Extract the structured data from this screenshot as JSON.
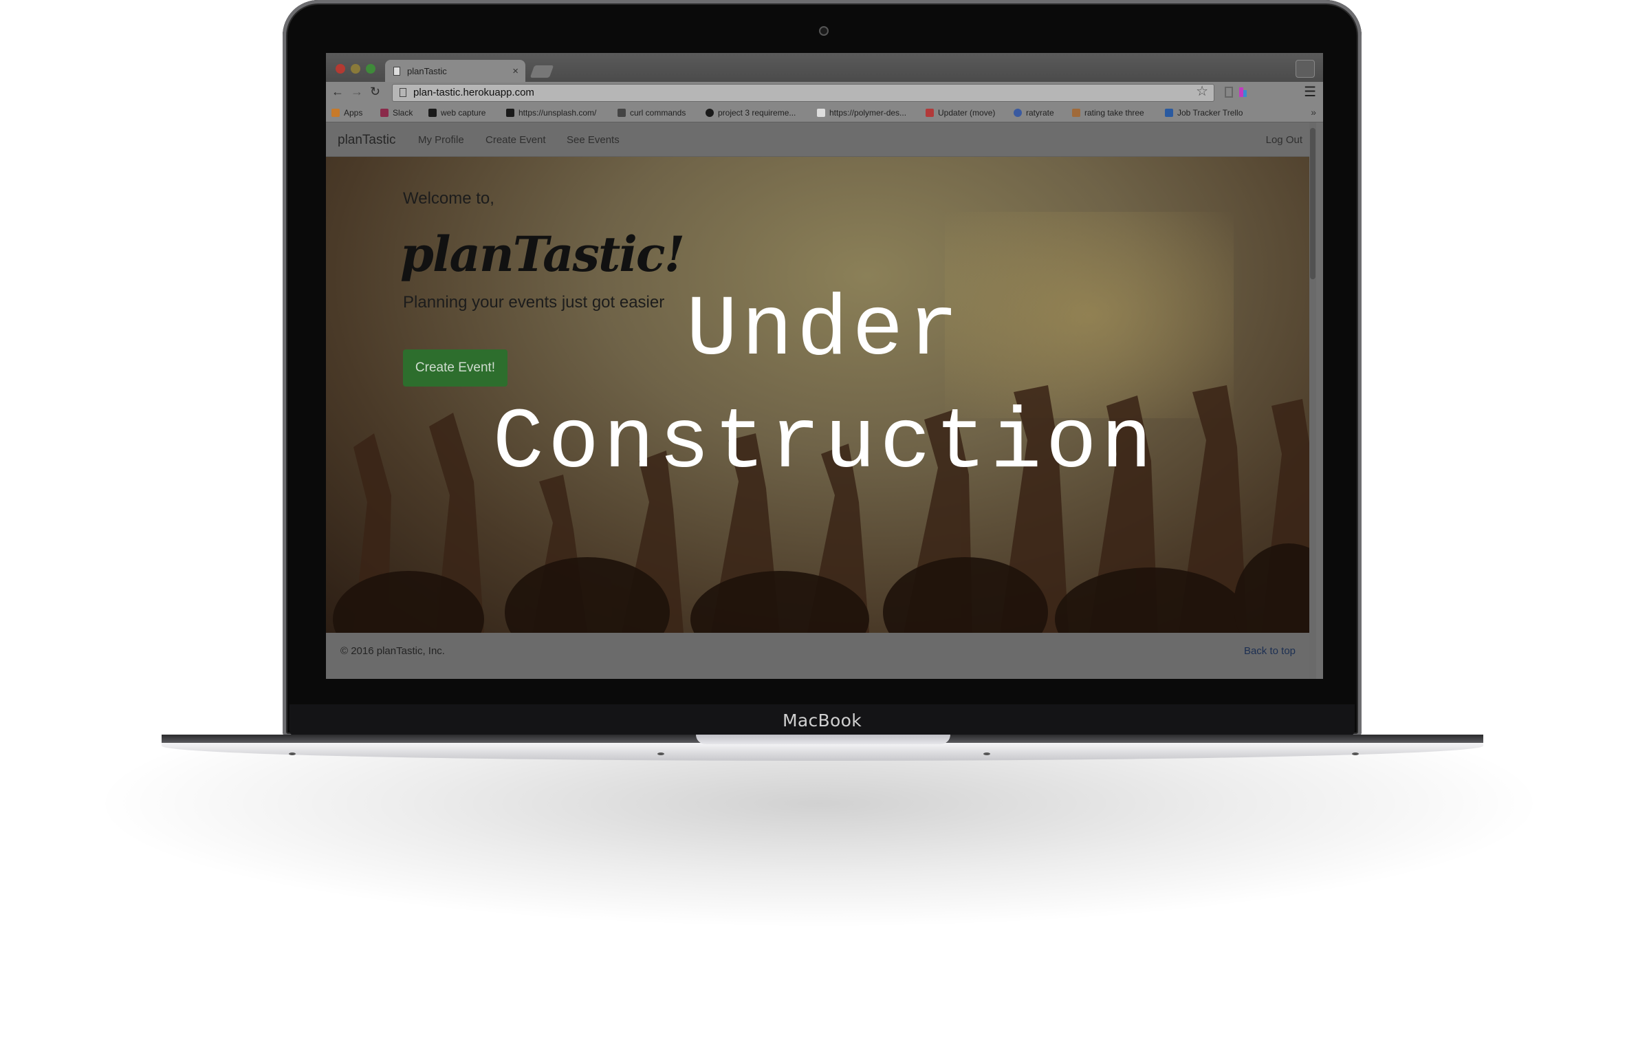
{
  "device": {
    "brand_label": "MacBook"
  },
  "browser": {
    "tab_title": "planTastic",
    "url": "plan-tastic.herokuapp.com",
    "bookmarks": [
      {
        "label": "Apps",
        "icon": "apps-grid-icon",
        "color": "#c77a2a"
      },
      {
        "label": "Slack",
        "icon": "slack-icon",
        "color": "#8a2a4a"
      },
      {
        "label": "web capture",
        "icon": "capture-icon",
        "color": "#1a1a1a"
      },
      {
        "label": "https://unsplash.com/",
        "icon": "camera-icon",
        "color": "#1a1a1a"
      },
      {
        "label": "curl commands",
        "icon": "slash-icon",
        "color": "#444444"
      },
      {
        "label": "project 3 requireme...",
        "icon": "github-icon",
        "color": "#1a1a1a"
      },
      {
        "label": "https://polymer-des...",
        "icon": "page-icon",
        "color": "#dddddd"
      },
      {
        "label": "Updater (move)",
        "icon": "list-icon",
        "color": "#b23a3a"
      },
      {
        "label": "ratyrate",
        "icon": "globe-icon",
        "color": "#3a5aa0"
      },
      {
        "label": "rating take three",
        "icon": "puzzle-icon",
        "color": "#a06a3a"
      },
      {
        "label": "Job Tracker Trello",
        "icon": "trello-icon",
        "color": "#2a5aa0"
      }
    ],
    "bookmarks_more": "»"
  },
  "site": {
    "brand": "planTastic",
    "nav": [
      "My Profile",
      "Create Event",
      "See Events"
    ],
    "logout": "Log Out",
    "hero": {
      "welcome": "Welcome to,",
      "logo": "planTastic!",
      "tagline": "Planning your events just got easier",
      "cta": "Create Event!"
    },
    "footer": {
      "copyright": "© 2016 planTastic, Inc.",
      "back_to_top": "Back to top"
    }
  },
  "overlay": {
    "line1": "Under",
    "line2": "Construction"
  },
  "colors": {
    "cta_green": "#2d6e2d",
    "overlay_text": "#ffffff"
  }
}
